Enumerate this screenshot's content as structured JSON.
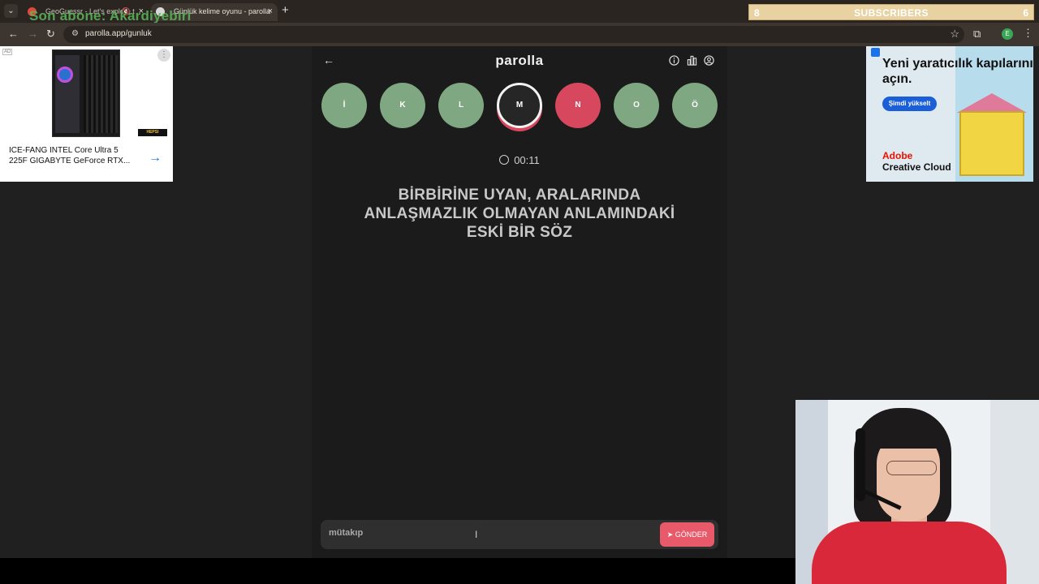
{
  "browser": {
    "tabs": [
      {
        "title": "GeoGuessr - Let's explore t",
        "active": false
      },
      {
        "title": "Günlük kelime oyunu - parolla",
        "active": true
      }
    ],
    "new_tab": "+",
    "url": "parolla.app/gunluk"
  },
  "stream_overlay": {
    "latest_sub": "Son abone: Akardiyebiri",
    "sub_goal": {
      "current": "8",
      "label": "SUBSCRIBERS",
      "target": "6"
    }
  },
  "ads": {
    "left": {
      "badge": "AD",
      "text": "ICE-FANG  INTEL Core Ultra 5 225F GIGABYTE GeForce RTX...",
      "logo_text": "HEPSI"
    },
    "right": {
      "headline": "Yeni yaratıcılık kapılarını açın.",
      "cta": "Şimdi yükselt",
      "brand_line1": "Adobe",
      "brand_line2": "Creative Cloud"
    }
  },
  "game": {
    "title": "parolla",
    "letters": [
      {
        "letter": "İ",
        "state": "correct"
      },
      {
        "letter": "K",
        "state": "correct"
      },
      {
        "letter": "L",
        "state": "correct"
      },
      {
        "letter": "M",
        "state": "current"
      },
      {
        "letter": "N",
        "state": "wrong"
      },
      {
        "letter": "O",
        "state": "correct"
      },
      {
        "letter": "Ö",
        "state": "correct"
      }
    ],
    "timer": "00:11",
    "question": "BİRBİRİNE UYAN, ARALARINDA ANLAŞMAZLIK OLMAYAN ANLAMINDAKİ ESKİ BİR SÖZ",
    "answer_value": "mütakıp",
    "send_label": "GÖNDER"
  },
  "colors": {
    "correct": "#7fa882",
    "wrong": "#d7475e",
    "accent": "#e85a6a"
  }
}
